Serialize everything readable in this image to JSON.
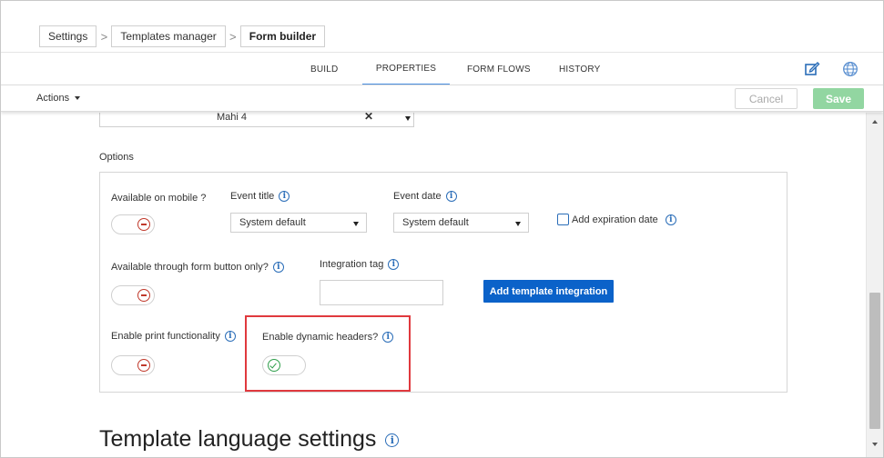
{
  "breadcrumb": [
    "Settings",
    "Templates manager",
    "Form builder"
  ],
  "tabs": [
    "BUILD",
    "PROPERTIES",
    "FORM FLOWS",
    "HISTORY"
  ],
  "active_tab": "PROPERTIES",
  "header_icons": [
    "edit-icon",
    "globe-icon"
  ],
  "actionbar": {
    "actions_label": "Actions",
    "cancel_label": "Cancel",
    "save_label": "Save"
  },
  "language_select": {
    "value": "Mahi 4",
    "clear": "✕"
  },
  "options": {
    "title": "Options",
    "available_on_mobile": {
      "label": "Available on mobile ?",
      "enabled": false
    },
    "event_title": {
      "label": "Event title",
      "value": "System default"
    },
    "event_date": {
      "label": "Event date",
      "value": "System default"
    },
    "add_expiration_date": {
      "label": "Add expiration date",
      "checked": false
    },
    "form_button_only": {
      "label": "Available through form button only?",
      "enabled": false
    },
    "integration_tag": {
      "label": "Integration tag",
      "value": ""
    },
    "add_integration_label": "Add template integration",
    "print_functionality": {
      "label": "Enable print functionality",
      "enabled": false
    },
    "dynamic_headers": {
      "label": "Enable dynamic headers?",
      "enabled": true
    }
  },
  "section_heading": "Template language settings",
  "info_glyph": "i",
  "colors": {
    "primary_button": "#0b62c9",
    "save_button": "#92d6a1",
    "active_tab_underline": "#4a90e2",
    "toggle_off": "#c0392b",
    "toggle_on": "#2e9e4a",
    "highlight": "#e0393e"
  }
}
